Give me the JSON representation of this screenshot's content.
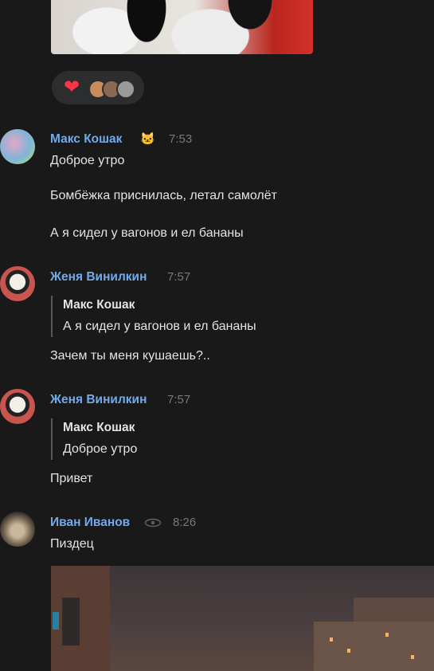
{
  "reactions": {
    "emoji": "heart",
    "avatar_colors": [
      "#c98b5a",
      "#8a6a55",
      "#9a9a9a"
    ]
  },
  "messages": [
    {
      "author": "Макс Кошак",
      "author_icon": "cat-face-icon",
      "time": "7:53",
      "lines": [
        "Доброе утро",
        "Бомбёжка приснилась, летал самолёт",
        "А я сидел у вагонов и ел бананы"
      ]
    },
    {
      "author": "Женя Винилкин",
      "time": "7:57",
      "reply": {
        "author": "Макс Кошак",
        "text": "А я сидел у вагонов и ел бананы"
      },
      "lines": [
        "Зачем ты меня кушаешь?.."
      ]
    },
    {
      "author": "Женя Винилкин",
      "time": "7:57",
      "reply": {
        "author": "Макс Кошак",
        "text": "Доброе утро"
      },
      "lines": [
        "Привет"
      ]
    },
    {
      "author": "Иван Иванов",
      "author_icon": "eye-icon",
      "time": "8:26",
      "lines": [
        "Пиздец"
      ]
    }
  ],
  "colors": {
    "background": "#19191a",
    "author_name": "#71aaeb",
    "timestamp": "#76787a",
    "text": "#e1e3e6",
    "reaction_heart": "#ff3347"
  }
}
